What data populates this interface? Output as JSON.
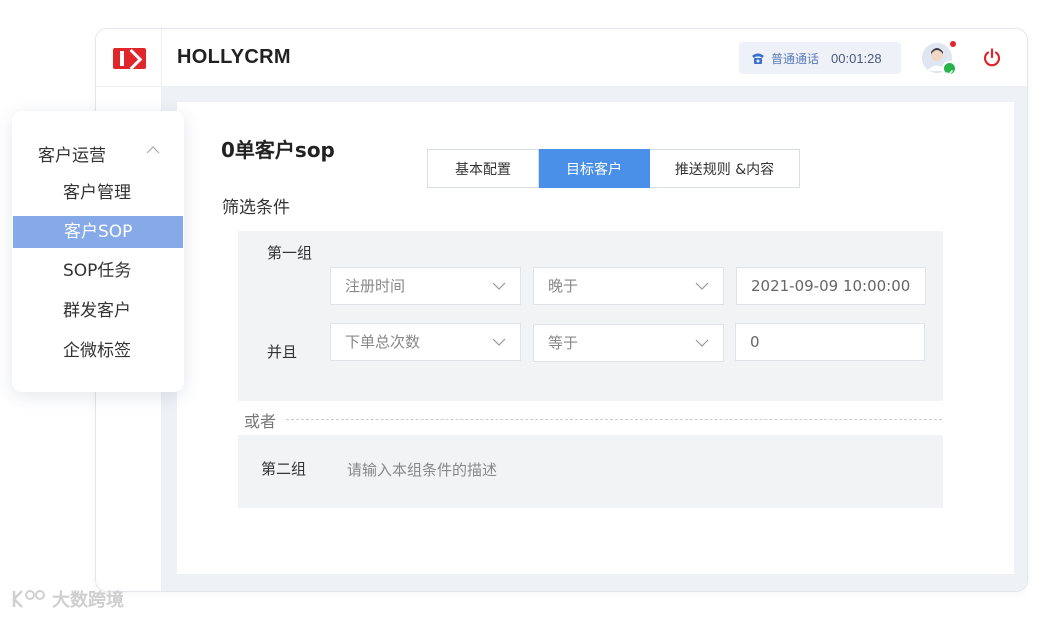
{
  "app": {
    "title": "HOLLYCRM"
  },
  "call": {
    "type": "普通通话",
    "timer": "00:01:28"
  },
  "menu": {
    "group": "客户运营",
    "items": [
      {
        "label": "客户管理",
        "active": false
      },
      {
        "label": "客户SOP",
        "active": true
      },
      {
        "label": "SOP任务",
        "active": false
      },
      {
        "label": "群发客户",
        "active": false
      },
      {
        "label": "企微标签",
        "active": false
      }
    ]
  },
  "page": {
    "title": "0单客户sop",
    "tabs": [
      {
        "label": "基本配置",
        "active": false
      },
      {
        "label": "目标客户",
        "active": true
      },
      {
        "label": "推送规则 &内容",
        "active": false
      }
    ],
    "section_title": "筛选条件",
    "group1": {
      "label": "第一组",
      "rows": [
        {
          "connector": "",
          "field": "注册时间",
          "operator": "晚于",
          "value": "2021-09-09 10:00:00"
        },
        {
          "connector": "并且",
          "field": "下单总次数",
          "operator": "等于",
          "value": "0"
        }
      ]
    },
    "or_label": "或者",
    "group2": {
      "label": "第二组",
      "placeholder": "请输入本组条件的描述"
    }
  },
  "watermark": "大数跨境",
  "colors": {
    "brand_red": "#e0262a",
    "accent_blue": "#4a8fe8",
    "menu_active": "#86a9e8",
    "status_green": "#27b34a"
  }
}
